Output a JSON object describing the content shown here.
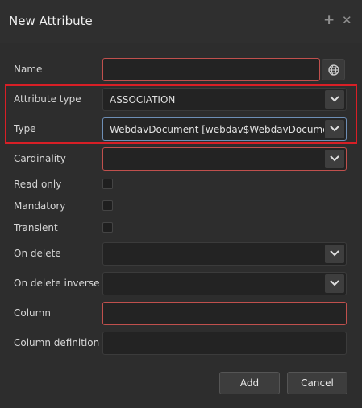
{
  "dialog": {
    "title": "New Attribute",
    "add_icon": "plus-icon",
    "close_icon": "close-icon"
  },
  "fields": {
    "name": {
      "label": "Name",
      "value": ""
    },
    "attribute_type": {
      "label": "Attribute type",
      "value": "ASSOCIATION"
    },
    "type": {
      "label": "Type",
      "value": "WebdavDocument [webdav$WebdavDocument"
    },
    "cardinality": {
      "label": "Cardinality",
      "value": ""
    },
    "read_only": {
      "label": "Read only",
      "checked": false
    },
    "mandatory": {
      "label": "Mandatory",
      "checked": false
    },
    "transient": {
      "label": "Transient",
      "checked": false
    },
    "on_delete": {
      "label": "On delete",
      "value": ""
    },
    "on_delete_inverse": {
      "label": "On delete inverse",
      "value": ""
    },
    "column": {
      "label": "Column",
      "value": ""
    },
    "column_definition": {
      "label": "Column definition",
      "value": ""
    }
  },
  "buttons": {
    "add": "Add",
    "cancel": "Cancel"
  },
  "colors": {
    "highlight": "#d81f26",
    "error_border": "#c0504d",
    "focus_border": "#6e8fb6"
  }
}
